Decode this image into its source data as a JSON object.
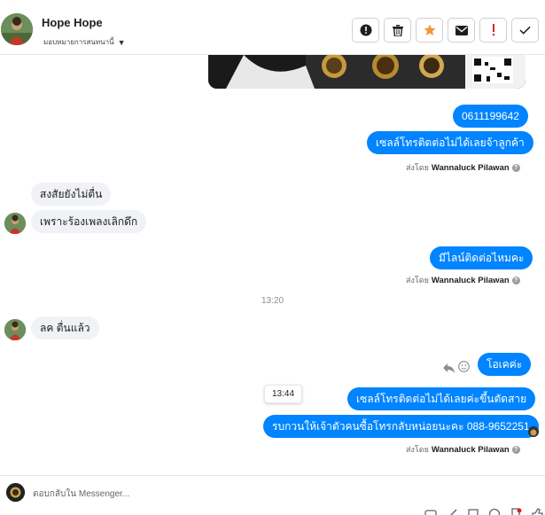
{
  "header": {
    "name": "Hope Hope",
    "subtitle": "มอบหมายการสนทนานี้"
  },
  "messages": {
    "phone": "0611199642",
    "sale_contact": "เซลล์โทรติดต่อไม่ได้เลยจ้าลูกค้า",
    "sent_by_label": "ส่งโดย",
    "agent_name": "Wannaluck Pilawan",
    "in_doubt": "สงสัยยังไม่ตื่น",
    "in_song": "เพราะร้องเพลงเลิกดึก",
    "line_question": "มีไลน์ติดต่อไหมคะ",
    "time_1320": "13:20",
    "in_awake": "ลค ตื่นแล้ว",
    "ok": "โอเคค่ะ",
    "tooltip_time": "13:44",
    "sale_busy": "เซลล์โทรติดต่อไม่ได้เลยค่ะขึ้นตัดสาย",
    "callback": "รบกวนให้เจ้าตัวคนซื้อโทรกลับหน่อยนะคะ  088-9652251"
  },
  "composer": {
    "placeholder": "ตอบกลับใน Messenger..."
  },
  "colors": {
    "outgoing": "#0084ff",
    "incoming": "#f0f2f5",
    "star": "#f7923a",
    "alert": "#e02020"
  },
  "icons": [
    "alert-circle-icon",
    "trash-icon",
    "star-icon",
    "envelope-icon",
    "exclamation-icon",
    "check-icon",
    "reply-icon",
    "emoji-icon"
  ]
}
